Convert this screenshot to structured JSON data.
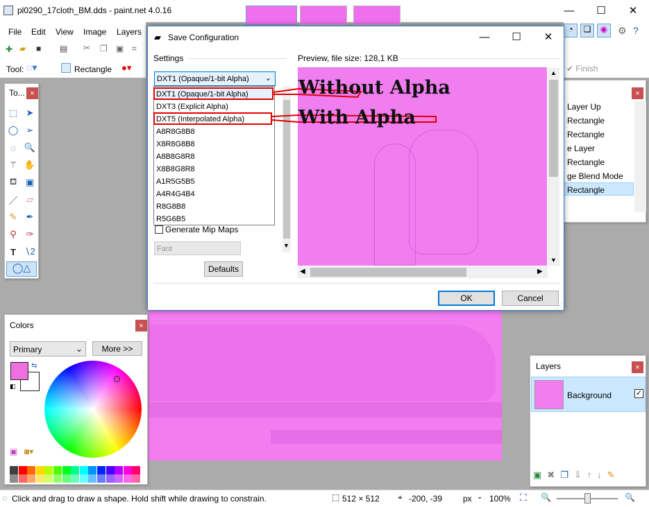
{
  "app": {
    "title": "pl0290_17cloth_BM.dds - paint.net 4.0.16",
    "minimize": "—",
    "maximize": "☐",
    "close": "✕"
  },
  "menu": [
    "File",
    "Edit",
    "View",
    "Image",
    "Layers"
  ],
  "toolbar2": {
    "tool_label": "Tool:",
    "shape_label": "Rectangle"
  },
  "right_toolbar": {
    "finish": "Finish"
  },
  "tools_panel": {
    "title": "To..."
  },
  "history_panel": {
    "items": [
      "Layer Up",
      "Rectangle",
      "Rectangle",
      "e Layer",
      "Rectangle",
      "ge Blend Mode",
      "Rectangle"
    ]
  },
  "colors_panel": {
    "title": "Colors",
    "primary_select": "Primary",
    "more_button": "More >>",
    "primary_color": "#ee6fdf",
    "secondary_color": "#ffffff",
    "palette": [
      "#404040",
      "#ff0000",
      "#ff6a00",
      "#ffd800",
      "#b6ff00",
      "#4cff00",
      "#00ff21",
      "#00ff90",
      "#00ffff",
      "#0094ff",
      "#0026ff",
      "#4800ff",
      "#b200ff",
      "#ff00dc",
      "#ff006e"
    ]
  },
  "layers_panel": {
    "title": "Layers",
    "layer_name": "Background"
  },
  "dialog": {
    "title": "Save Configuration",
    "settings_label": "Settings",
    "preview_label": "Preview, file size: 128,1 KB",
    "selected_format": "DXT1 (Opaque/1-bit Alpha)",
    "formats": [
      "DXT1 (Opaque/1-bit Alpha)",
      "DXT3 (Explicit Alpha)",
      "DXT5 (Interpolated Alpha)",
      "A8R8G8B8",
      "X8R8G8B8",
      "A8B8G8R8",
      "X8B8G8R8",
      "A1R5G5B5",
      "A4R4G4B4",
      "R8G8B8",
      "R5G6B5"
    ],
    "mipmaps_label": "Generate Mip Maps",
    "filter_select": "Fant",
    "defaults_button": "Defaults",
    "ok_button": "OK",
    "cancel_button": "Cancel"
  },
  "annotations": {
    "without_alpha": "Without Alpha",
    "with_alpha": "With Alpha"
  },
  "status": {
    "hint": "Click and drag to draw a shape. Hold shift while drawing to constrain.",
    "size": "512 × 512",
    "cursor": "-200, -39",
    "unit": "px",
    "zoom": "100%"
  }
}
